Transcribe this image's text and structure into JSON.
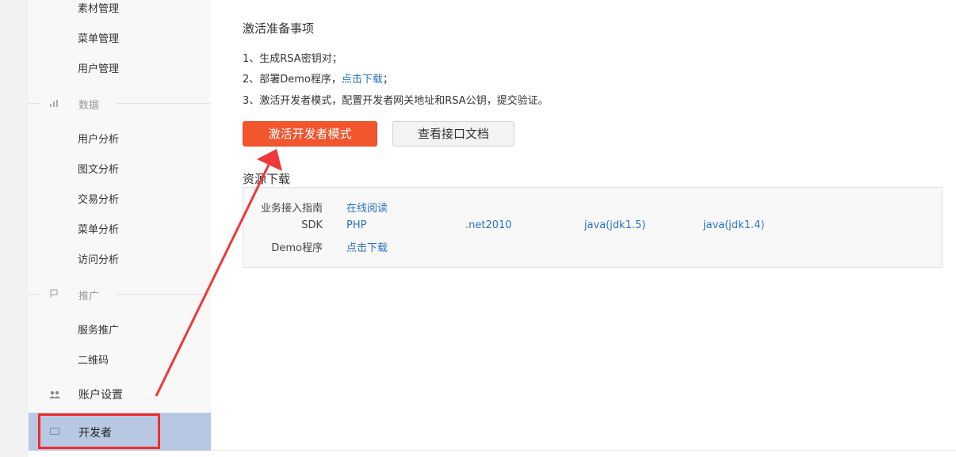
{
  "sidebar": {
    "top_items": [
      "素材管理",
      "菜单管理",
      "用户管理"
    ],
    "data_section": {
      "label": "数据",
      "items": [
        "用户分析",
        "图文分析",
        "交易分析",
        "菜单分析",
        "访问分析"
      ]
    },
    "promo_section": {
      "label": "推广",
      "items": [
        "服务推广",
        "二维码"
      ]
    },
    "account_settings": "账户设置",
    "developer": "开发者"
  },
  "main": {
    "title": "激活准备事项",
    "steps": {
      "step1": "1、生成RSA密钥对；",
      "step2_prefix": "2、部署Demo程序，",
      "step2_link": "点击下载",
      "step2_suffix": "；",
      "step3": "3、激活开发者模式，配置开发者网关地址和RSA公钥，提交验证。"
    },
    "buttons": {
      "activate": "激活开发者模式",
      "docs": "查看接口文档"
    },
    "resources": {
      "title": "资源下载",
      "rows": [
        {
          "label": "业务接入指南",
          "links": [
            "在线阅读"
          ]
        },
        {
          "label": "SDK",
          "links": [
            "PHP",
            ".net2010",
            "java(jdk1.5)",
            "java(jdk1.4)"
          ]
        },
        {
          "label": "Demo程序",
          "links": [
            "点击下载"
          ]
        }
      ]
    }
  },
  "colors": {
    "accent": "#f2562f",
    "link": "#2a73c0",
    "selected_bg": "#b8c8e2",
    "annotation": "#f22b2b"
  }
}
